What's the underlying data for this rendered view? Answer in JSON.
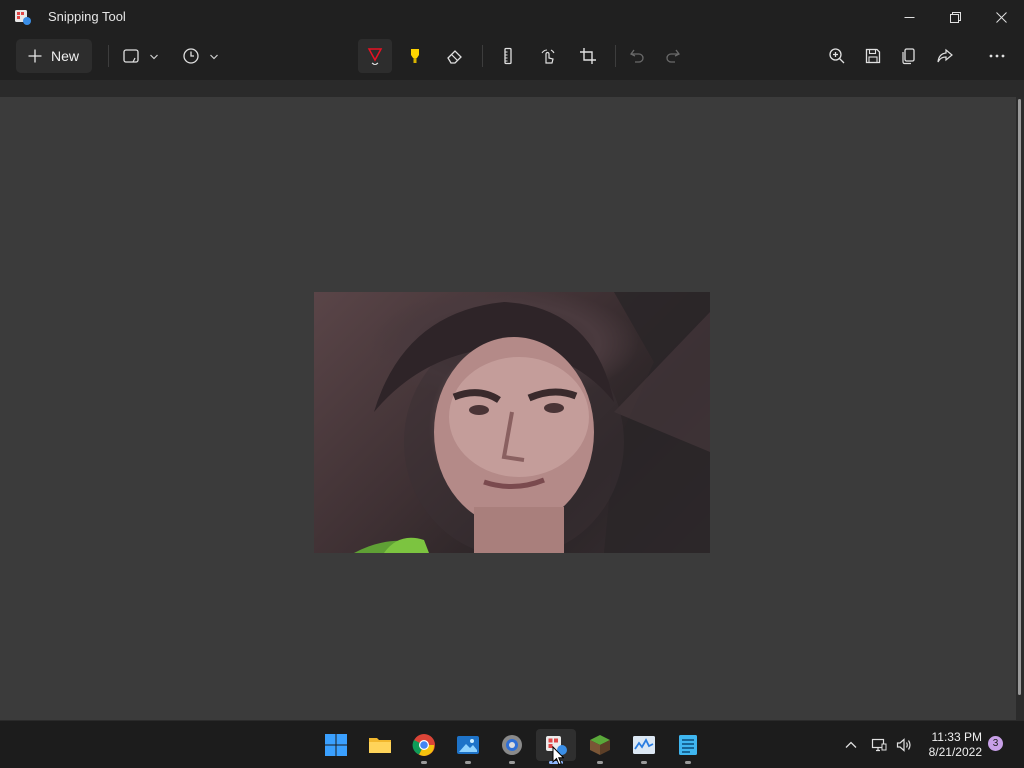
{
  "window": {
    "title": "Snipping Tool"
  },
  "toolbar": {
    "new_label": "New",
    "mode_icon": "rectangle-snip-icon",
    "delay_icon": "clock-icon",
    "tools": [
      "ballpoint-pen-icon",
      "highlighter-icon",
      "eraser-icon",
      "ruler-icon",
      "touch-writing-icon",
      "crop-icon",
      "undo-icon",
      "redo-icon"
    ],
    "actions": [
      "zoom-icon",
      "save-icon",
      "copy-icon",
      "share-icon",
      "more-icon"
    ],
    "pen_color": "#e81123",
    "highlighter_color": "#ffd400"
  },
  "canvas": {
    "image": "captured-portrait-snip"
  },
  "taskbar": {
    "apps": [
      "start-icon",
      "file-explorer-icon",
      "chrome-icon",
      "photos-icon",
      "settings-icon",
      "snipping-tool-icon",
      "minecraft-icon",
      "task-manager-icon",
      "notepad-icon"
    ],
    "time": "11:33 PM",
    "date": "8/21/2022",
    "notification_count": "3"
  }
}
